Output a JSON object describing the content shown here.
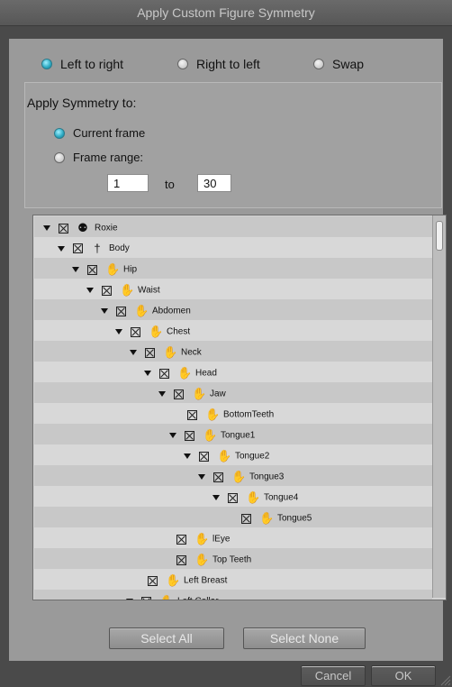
{
  "window": {
    "title": "Apply Custom Figure Symmetry"
  },
  "direction": {
    "options": [
      "Left to right",
      "Right to left",
      "Swap"
    ],
    "selected": "Left to right"
  },
  "apply_to": {
    "heading": "Apply Symmetry to:",
    "current_frame_label": "Current frame",
    "frame_range_label": "Frame range:",
    "selected": "Current frame",
    "range_start": "1",
    "to_label": "to",
    "range_end": "30"
  },
  "tree": {
    "rows": [
      {
        "label": "Roxie",
        "icon": "figure-icon",
        "expanded": true
      },
      {
        "label": "Body",
        "icon": "body-icon",
        "expanded": true
      },
      {
        "label": "Hip",
        "icon": "hand-icon",
        "expanded": true
      },
      {
        "label": "Waist",
        "icon": "hand-icon",
        "expanded": true
      },
      {
        "label": "Abdomen",
        "icon": "hand-icon",
        "expanded": true
      },
      {
        "label": "Chest",
        "icon": "hand-icon",
        "expanded": true
      },
      {
        "label": "Neck",
        "icon": "hand-icon",
        "expanded": true
      },
      {
        "label": "Head",
        "icon": "hand-icon",
        "expanded": true
      },
      {
        "label": "Jaw",
        "icon": "hand-icon",
        "expanded": true
      },
      {
        "label": "BottomTeeth",
        "icon": "hand-icon",
        "expanded": false
      },
      {
        "label": "Tongue1",
        "icon": "hand-icon",
        "expanded": true
      },
      {
        "label": "Tongue2",
        "icon": "hand-icon",
        "expanded": true
      },
      {
        "label": "Tongue3",
        "icon": "hand-icon",
        "expanded": true
      },
      {
        "label": "Tongue4",
        "icon": "hand-icon",
        "expanded": true
      },
      {
        "label": "Tongue5",
        "icon": "hand-icon",
        "expanded": false
      },
      {
        "label": "lEye",
        "icon": "hand-icon",
        "expanded": false
      },
      {
        "label": "Top Teeth",
        "icon": "hand-icon",
        "expanded": false
      },
      {
        "label": "Left Breast",
        "icon": "hand-icon",
        "expanded": false
      },
      {
        "label": "Left Collar",
        "icon": "hand-icon",
        "expanded": true
      }
    ]
  },
  "buttons": {
    "select_all": "Select All",
    "select_none": "Select None",
    "cancel": "Cancel",
    "ok": "OK"
  },
  "colors": {
    "radio_selected": "#2aa7c0",
    "panel_bg": "#9a9a9a",
    "window_bg": "#4a4a4a"
  }
}
